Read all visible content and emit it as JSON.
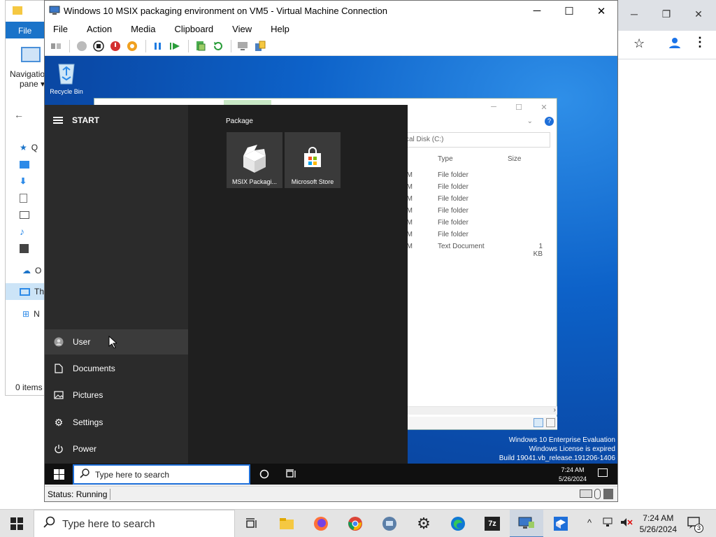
{
  "host_explorer": {
    "ribbon_file": "File",
    "nav_pane_label_1": "Navigatio",
    "nav_pane_label_2": "pane ▾",
    "tree": [
      "Q",
      "",
      "",
      "",
      "",
      "",
      "",
      "O",
      "Th",
      "N"
    ],
    "status": "0 items"
  },
  "vm_window": {
    "title": "Windows 10 MSIX packaging environment on VM5 - Virtual Machine Connection",
    "menu": [
      "File",
      "Action",
      "Media",
      "Clipboard",
      "View",
      "Help"
    ],
    "status": "Status: Running"
  },
  "vm_desktop": {
    "recycle_bin": "Recycle Bin",
    "watermark_line1": "Windows 10 Enterprise Evaluation",
    "watermark_line2": "Windows License is expired",
    "watermark_line3": "Build 19041.vb_release.191206-1406"
  },
  "inner_explorer": {
    "address": "cal Disk (C:)",
    "col_type": "Type",
    "col_size": "Size",
    "rows": [
      {
        "time": "AM",
        "type": "File folder",
        "size": ""
      },
      {
        "time": "AM",
        "type": "File folder",
        "size": ""
      },
      {
        "time": "AM",
        "type": "File folder",
        "size": ""
      },
      {
        "time": "PM",
        "type": "File folder",
        "size": ""
      },
      {
        "time": "AM",
        "type": "File folder",
        "size": ""
      },
      {
        "time": "AM",
        "type": "File folder",
        "size": ""
      },
      {
        "time": "PM",
        "type": "Text Document",
        "size": "1 KB"
      }
    ]
  },
  "start_menu": {
    "header": "START",
    "group_label": "Package",
    "tiles": [
      {
        "label": "MSIX Packagi...",
        "icon": "package-box-icon"
      },
      {
        "label": "Microsoft Store",
        "icon": "store-bag-icon"
      }
    ],
    "items": {
      "user": "User",
      "documents": "Documents",
      "pictures": "Pictures",
      "settings": "Settings",
      "power": "Power"
    }
  },
  "vm_taskbar": {
    "search_placeholder": "Type here to search",
    "time": "7:24 AM",
    "date": "5/26/2024"
  },
  "host_taskbar": {
    "search_placeholder": "Type here to search",
    "time": "7:24 AM",
    "date": "5/26/2024",
    "notification_count": "3",
    "apps": [
      "task-view-icon",
      "file-explorer-icon",
      "firefox-icon",
      "chrome-icon",
      "remote-desktop-icon",
      "settings-gear-icon",
      "edge-icon",
      "7zip-icon",
      "vm-connection-icon",
      "msix-packaging-icon"
    ]
  },
  "colors": {
    "accent": "#1e6fd9",
    "desktop_blue": "#0d62c9",
    "start_bg": "#1f1f1f",
    "start_left_bg": "#2b2b2b",
    "tile_bg": "#3a3a3a"
  }
}
